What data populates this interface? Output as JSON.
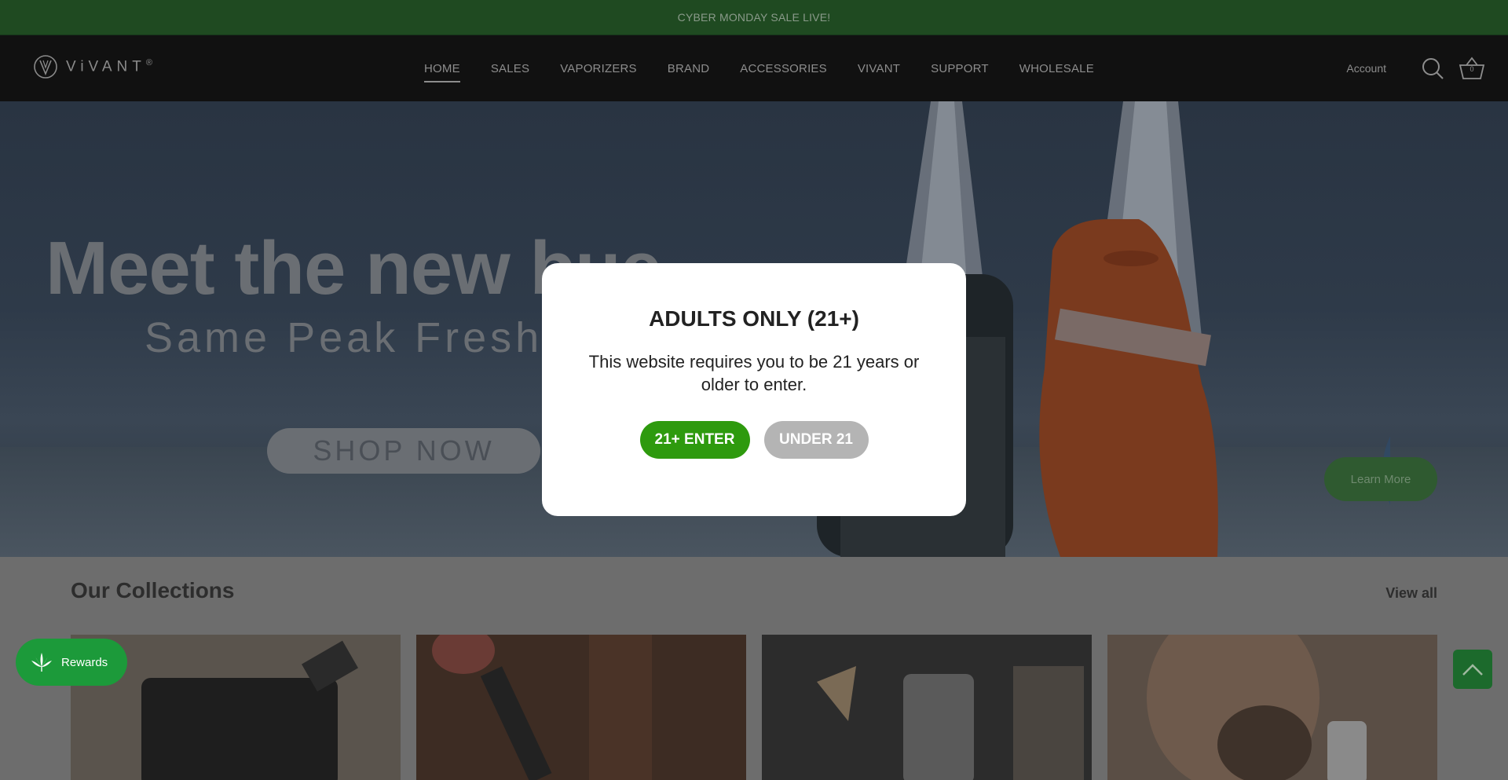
{
  "announcement": {
    "text": "CYBER MONDAY SALE LIVE!"
  },
  "header": {
    "logo_text": "ViVANT",
    "logo_mark": "®",
    "nav": [
      {
        "label": "HOME",
        "active": true
      },
      {
        "label": "SALES",
        "active": false
      },
      {
        "label": "VAPORIZERS",
        "active": false
      },
      {
        "label": "BRAND",
        "active": false
      },
      {
        "label": "ACCESSORIES",
        "active": false
      },
      {
        "label": "VIVANT",
        "active": false
      },
      {
        "label": "SUPPORT",
        "active": false
      },
      {
        "label": "WHOLESALE",
        "active": false
      }
    ],
    "account_label": "Account",
    "search_icon": "search-icon",
    "cart_icon": "basket-icon",
    "cart_count": "0"
  },
  "hero": {
    "title": "Meet the new bue",
    "subtitle": "Same Peak Fresh",
    "shop_button": "SHOP NOW",
    "learn_more_button": "Learn More"
  },
  "collections": {
    "title": "Our Collections",
    "view_all": "View all"
  },
  "age_gate": {
    "title": "ADULTS ONLY (21+)",
    "message": "This website requires you to be 21 years or older to enter.",
    "enter_button": "21+ ENTER",
    "under_button": "UNDER 21",
    "enter_color": "#2e9a0e",
    "under_color": "#b4b4b4"
  },
  "widgets": {
    "rewards_label": "Rewards",
    "rewards_icon": "leaf-icon",
    "back_to_top_icon": "chevron-up-icon"
  },
  "colors": {
    "announcement_bg": "#1f4a21",
    "header_bg": "#111111",
    "rewards_bg": "#1c9a3a"
  }
}
